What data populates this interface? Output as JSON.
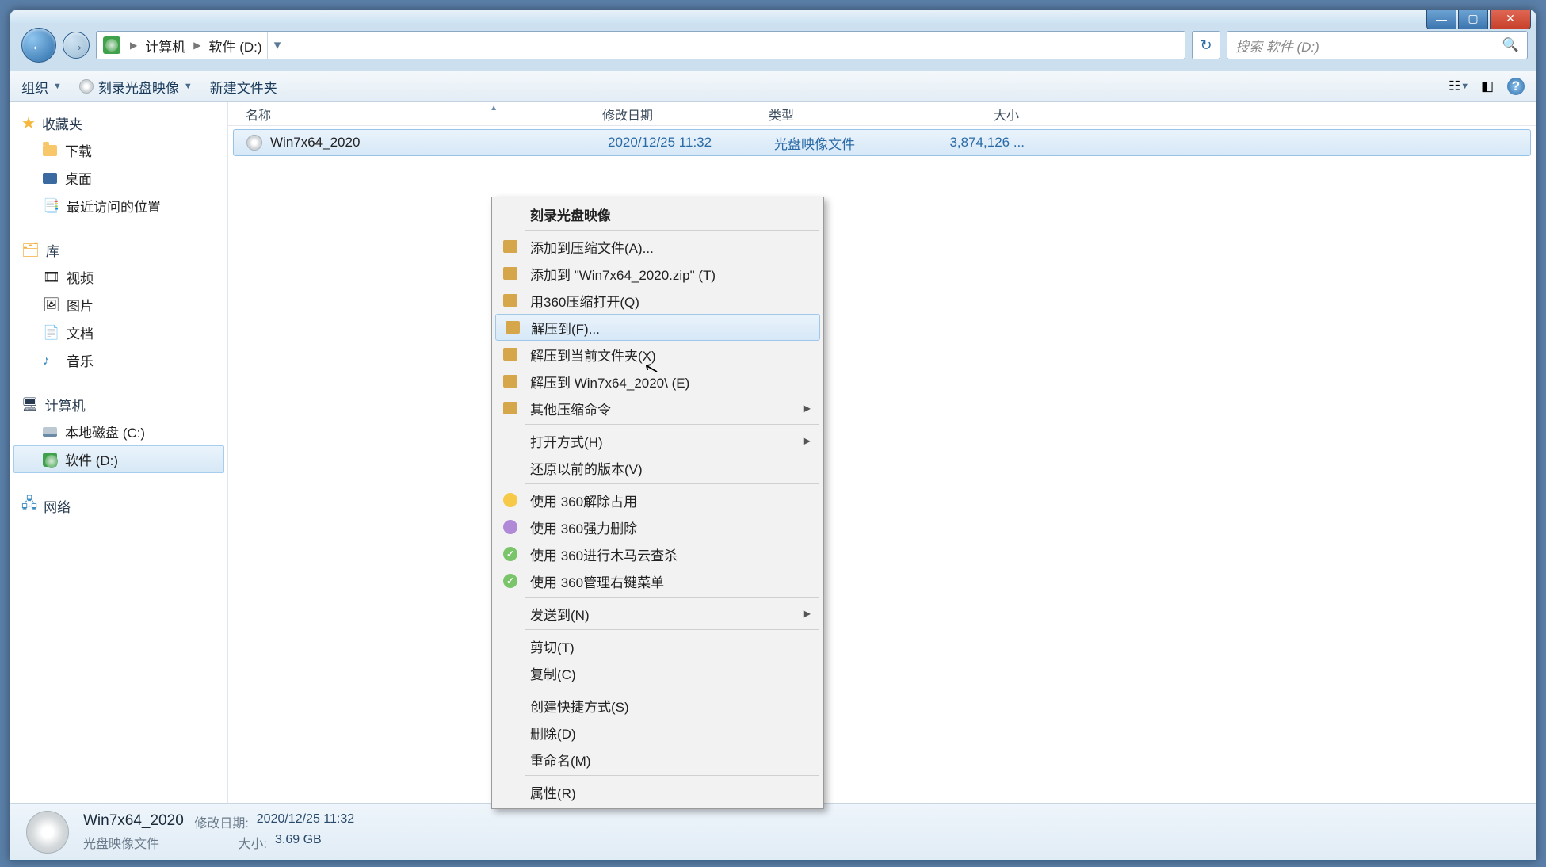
{
  "breadcrumb": {
    "root": "计算机",
    "loc": "软件 (D:)"
  },
  "search": {
    "placeholder": "搜索 软件 (D:)"
  },
  "toolbar": {
    "organize": "组织",
    "burn": "刻录光盘映像",
    "newfolder": "新建文件夹"
  },
  "sidebar": {
    "fav_head": "收藏夹",
    "fav": {
      "downloads": "下载",
      "desktop": "桌面",
      "recent": "最近访问的位置"
    },
    "lib_head": "库",
    "lib": {
      "video": "视频",
      "pictures": "图片",
      "docs": "文档",
      "music": "音乐"
    },
    "comp_head": "计算机",
    "comp": {
      "c": "本地磁盘 (C:)",
      "d": "软件 (D:)"
    },
    "net_head": "网络"
  },
  "columns": {
    "name": "名称",
    "date": "修改日期",
    "type": "类型",
    "size": "大小"
  },
  "file": {
    "name": "Win7x64_2020",
    "date": "2020/12/25 11:32",
    "type": "光盘映像文件",
    "size": "3,874,126 ..."
  },
  "ctx": {
    "burn": "刻录光盘映像",
    "addarc": "添加到压缩文件(A)...",
    "addzip": "添加到 \"Win7x64_2020.zip\" (T)",
    "open360": "用360压缩打开(Q)",
    "extractto": "解压到(F)...",
    "extracthere": "解压到当前文件夹(X)",
    "extractfolder": "解压到 Win7x64_2020\\ (E)",
    "othercomp": "其他压缩命令",
    "openwith": "打开方式(H)",
    "restore": "还原以前的版本(V)",
    "unlock360": "使用 360解除占用",
    "forcedel360": "使用 360强力删除",
    "scan360": "使用 360进行木马云查杀",
    "menu360": "使用 360管理右键菜单",
    "sendto": "发送到(N)",
    "cut": "剪切(T)",
    "copy": "复制(C)",
    "shortcut": "创建快捷方式(S)",
    "delete": "删除(D)",
    "rename": "重命名(M)",
    "props": "属性(R)"
  },
  "details": {
    "name": "Win7x64_2020",
    "type": "光盘映像文件",
    "date_label": "修改日期:",
    "date": "2020/12/25 11:32",
    "size_label": "大小:",
    "size": "3.69 GB"
  }
}
